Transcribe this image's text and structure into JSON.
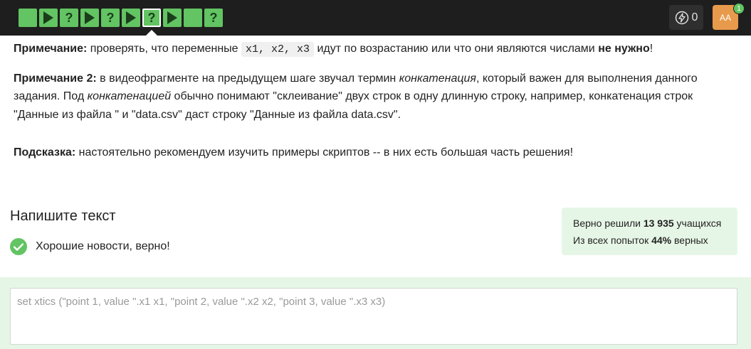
{
  "topbar": {
    "steps": [
      {
        "type": "text",
        "label": ""
      },
      {
        "type": "play",
        "label": ""
      },
      {
        "type": "quiz",
        "label": "?"
      },
      {
        "type": "play",
        "label": ""
      },
      {
        "type": "quiz",
        "label": "?"
      },
      {
        "type": "play",
        "label": ""
      },
      {
        "type": "quiz",
        "label": "?",
        "current": true
      },
      {
        "type": "play",
        "label": ""
      },
      {
        "type": "text",
        "label": ""
      },
      {
        "type": "quiz",
        "label": "?"
      }
    ],
    "energy_count": "0",
    "avatar_initials": "AA",
    "notification_count": "1",
    "accent_color": "#62c462"
  },
  "content": {
    "note1": {
      "label": "Примечание:",
      "text_before": " проверять, что переменные ",
      "code": "x1, x2, x3",
      "text_after": " идут по возрастанию или что они являются числами ",
      "bold_end": "не нужно",
      "end": "!"
    },
    "note2": {
      "label": "Примечание 2:",
      "t1": " в видеофрагменте на предыдущем шаге звучал термин ",
      "i1": "конкатенация",
      "t2": ", который важен для выполнения данного задания. Под ",
      "i2": "конкатенацией",
      "t3": " обычно понимают \"склеивание\" двух строк в одну длинную строку, например, конкатенация строк \"Данные из файла \" и \"data.csv\" даст строку \"Данные из файла data.csv\"."
    },
    "hint": {
      "label": "Подсказка:",
      "text": " настоятельно рекомендуем изучить примеры скриптов -- в них есть большая часть решения!"
    }
  },
  "task": {
    "title": "Напишите текст",
    "success_message": "Хорошие новости, верно!"
  },
  "stats": {
    "line1_prefix": "Верно решили ",
    "solved_count": "13 935",
    "line1_suffix": " учащихся",
    "line2_prefix": "Из всех попыток ",
    "percent": "44%",
    "line2_suffix": " верных"
  },
  "answer": {
    "value": "set xtics (\"point 1, value \".x1 x1, \"point 2, value \".x2 x2, \"point 3, value \".x3 x3)"
  }
}
